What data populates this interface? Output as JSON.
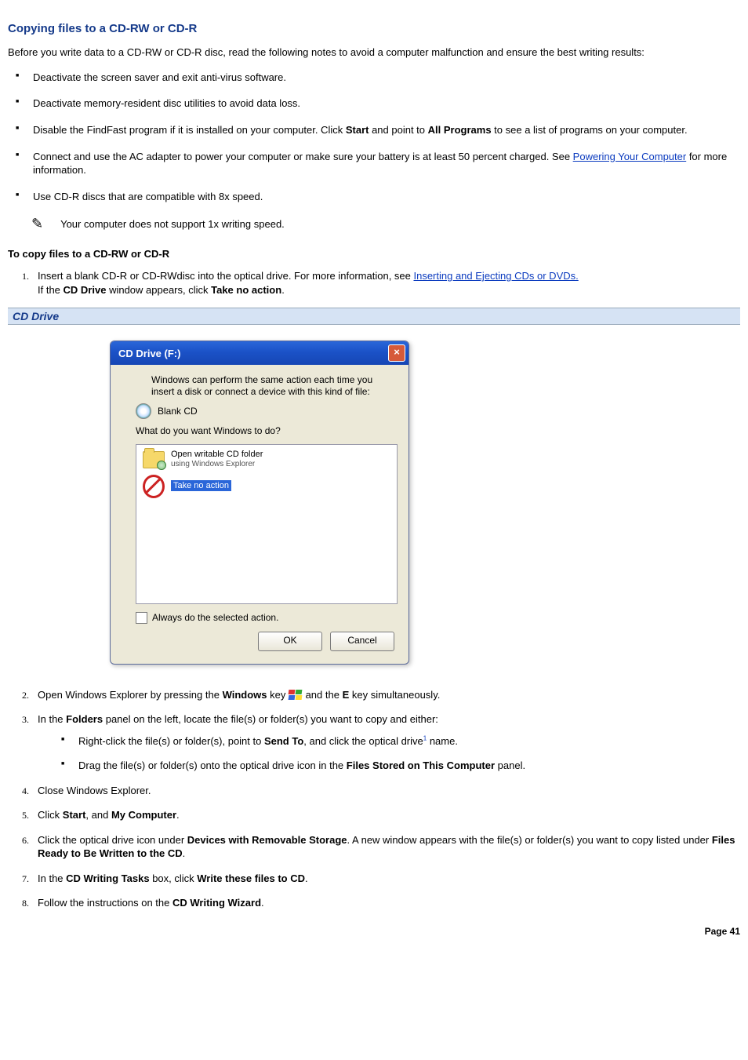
{
  "heading": "Copying files to a CD-RW or CD-R",
  "intro": "Before you write data to a CD-RW or CD-R disc, read the following notes to avoid a computer malfunction and ensure the best writing results:",
  "bullets": {
    "b1": "Deactivate the screen saver and exit anti-virus software.",
    "b2": "Deactivate memory-resident disc utilities to avoid data loss.",
    "b3_pre": "Disable the FindFast program if it is installed on your computer. Click ",
    "b3_bold1": "Start",
    "b3_mid": " and point to ",
    "b3_bold2": "All Programs",
    "b3_post": " to see a list of programs on your computer.",
    "b4_pre": "Connect and use the AC adapter to power your computer or make sure your battery is at least 50 percent charged. See ",
    "b4_link": "Powering Your Computer",
    "b4_post": " for more information.",
    "b5": "Use CD-R discs that are compatible with 8x speed."
  },
  "note": "Your computer does not support 1x writing speed.",
  "subheading": "To copy files to a CD-RW or CD-R",
  "steps": {
    "s1_pre": "Insert a blank CD-R or CD-RWdisc into the optical drive. For more information, see ",
    "s1_link": "Inserting and Ejecting CDs or DVDs.",
    "s1_line2_pre": "If the ",
    "s1_line2_bold": "CD Drive",
    "s1_line2_mid": " window appears, click ",
    "s1_line2_bold2": "Take no action",
    "s1_line2_post": ".",
    "s2_pre": "Open Windows Explorer by pressing the ",
    "s2_bold1": "Windows",
    "s2_mid1": " key ",
    "s2_mid2": " and the ",
    "s2_bold2": "E",
    "s2_post": " key simultaneously.",
    "s3_pre": "In the ",
    "s3_bold": "Folders",
    "s3_post": " panel on the left, locate the file(s) or folder(s) you want to copy and either:",
    "s3_sub1_pre": "Right-click the file(s) or folder(s), point to ",
    "s3_sub1_bold": "Send To",
    "s3_sub1_mid": ", and click the optical drive",
    "s3_sub1_post": " name.",
    "s3_sub2_pre": "Drag the file(s) or folder(s) onto the optical drive icon in the ",
    "s3_sub2_bold": "Files Stored on This Computer",
    "s3_sub2_post": " panel.",
    "s4": "Close Windows Explorer.",
    "s5_pre": "Click ",
    "s5_bold1": "Start",
    "s5_mid": ", and ",
    "s5_bold2": "My Computer",
    "s5_post": ".",
    "s6_pre": "Click the optical drive icon under ",
    "s6_bold1": "Devices with Removable Storage",
    "s6_mid": ". A new window appears with the file(s) or folder(s) you want to copy listed under ",
    "s6_bold2": "Files Ready to Be Written to the CD",
    "s6_post": ".",
    "s7_pre": "In the ",
    "s7_bold1": "CD Writing Tasks",
    "s7_mid": " box, click ",
    "s7_bold2": "Write these files to CD",
    "s7_post": ".",
    "s8_pre": "Follow the instructions on the ",
    "s8_bold": "CD Writing Wizard",
    "s8_post": "."
  },
  "figure_caption": "CD Drive",
  "dialog": {
    "title": "CD Drive (F:)",
    "instruction": "Windows can perform the same action each time you insert a disk or connect a device with this kind of file:",
    "media_label": "Blank CD",
    "question": "What do you want Windows to do?",
    "option1_main": "Open writable CD folder",
    "option1_sub": "using Windows Explorer",
    "option2_main": "Take no action",
    "checkbox_label": "Always do the selected action.",
    "ok": "OK",
    "cancel": "Cancel"
  },
  "page_number": "Page 41"
}
